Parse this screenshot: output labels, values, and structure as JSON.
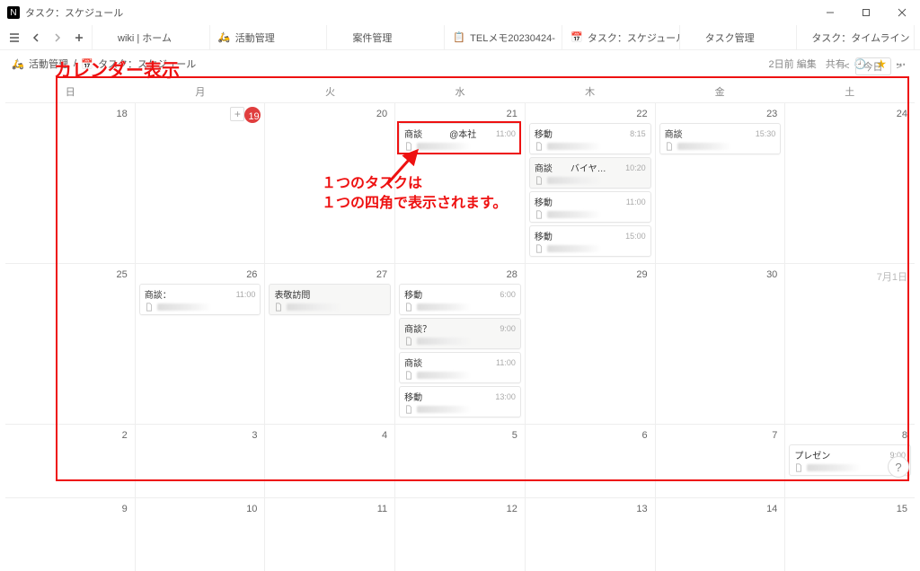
{
  "window": {
    "title": "タスク：スケジュール",
    "icon": "N"
  },
  "nav": {
    "tabs": [
      {
        "icon_class": "",
        "label": "wiki | ホーム"
      },
      {
        "icon_class": "i-bike",
        "icon": "🛵",
        "label": "活動管理"
      },
      {
        "icon_class": "",
        "label": "案件管理"
      },
      {
        "icon_class": "",
        "icon": "📋",
        "label": "TELメモ20230424-"
      },
      {
        "icon_class": "i-cal",
        "icon": "📅",
        "label": "タスク：スケジュール",
        "active": true
      },
      {
        "icon_class": "",
        "label": "タスク管理"
      },
      {
        "icon_class": "",
        "label": "タスク：タイムライン"
      }
    ]
  },
  "breadcrumb": {
    "item1_icon": "🛵",
    "item1": "活動管理",
    "sep": "/",
    "item2_icon": "📅",
    "item2": "タスク：スケジュール"
  },
  "rightbar": {
    "edited": "2日前 編集",
    "share": "共有"
  },
  "annotation": {
    "title": "カレンダー表示",
    "body_line1": "１つのタスクは",
    "body_line2": "１つの四角で表示されます。"
  },
  "calendar": {
    "today_label": "今日",
    "dow": [
      "日",
      "月",
      "火",
      "水",
      "木",
      "金",
      "土"
    ],
    "weeks": [
      {
        "short": false,
        "cells": [
          {
            "num": "18"
          },
          {
            "num": "19",
            "today": true,
            "add": true
          },
          {
            "num": "20"
          },
          {
            "num": "21",
            "tasks": [
              {
                "title": "商談　　　@本社",
                "time": "11:00",
                "grouped": false,
                "highlight": true
              }
            ]
          },
          {
            "num": "22",
            "tasks": [
              {
                "title": "移動",
                "time": "8:15"
              },
              {
                "title": "商談　　バイヤ…",
                "time": "10:20",
                "grouped": true
              },
              {
                "title": "移動",
                "time": "11:00"
              },
              {
                "title": "移動",
                "time": "15:00"
              }
            ]
          },
          {
            "num": "23",
            "tasks": [
              {
                "title": "商談",
                "time": "15:30"
              }
            ]
          },
          {
            "num": "24"
          }
        ]
      },
      {
        "short": false,
        "cells": [
          {
            "num": "25"
          },
          {
            "num": "26",
            "tasks": [
              {
                "title": "商談：",
                "time": "11:00"
              }
            ]
          },
          {
            "num": "27",
            "tasks": [
              {
                "title": "表敬訪問",
                "time": "",
                "grouped": true
              }
            ]
          },
          {
            "num": "28",
            "tasks": [
              {
                "title": "移動",
                "time": "6:00"
              },
              {
                "title": "商談？",
                "time": "9:00",
                "grouped": true
              },
              {
                "title": "商談",
                "time": "11:00"
              },
              {
                "title": "移動",
                "time": "13:00"
              }
            ]
          },
          {
            "num": "29"
          },
          {
            "num": "30"
          },
          {
            "num": "7月1日",
            "nextmonth": true
          }
        ]
      },
      {
        "short": true,
        "cells": [
          {
            "num": "2"
          },
          {
            "num": "3"
          },
          {
            "num": "4"
          },
          {
            "num": "5"
          },
          {
            "num": "6"
          },
          {
            "num": "7"
          },
          {
            "num": "8",
            "tasks": [
              {
                "title": "プレゼン",
                "time": "9:00"
              }
            ]
          }
        ]
      },
      {
        "short": true,
        "cells": [
          {
            "num": "9"
          },
          {
            "num": "10"
          },
          {
            "num": "11"
          },
          {
            "num": "12"
          },
          {
            "num": "13"
          },
          {
            "num": "14"
          },
          {
            "num": "15"
          }
        ]
      }
    ]
  }
}
